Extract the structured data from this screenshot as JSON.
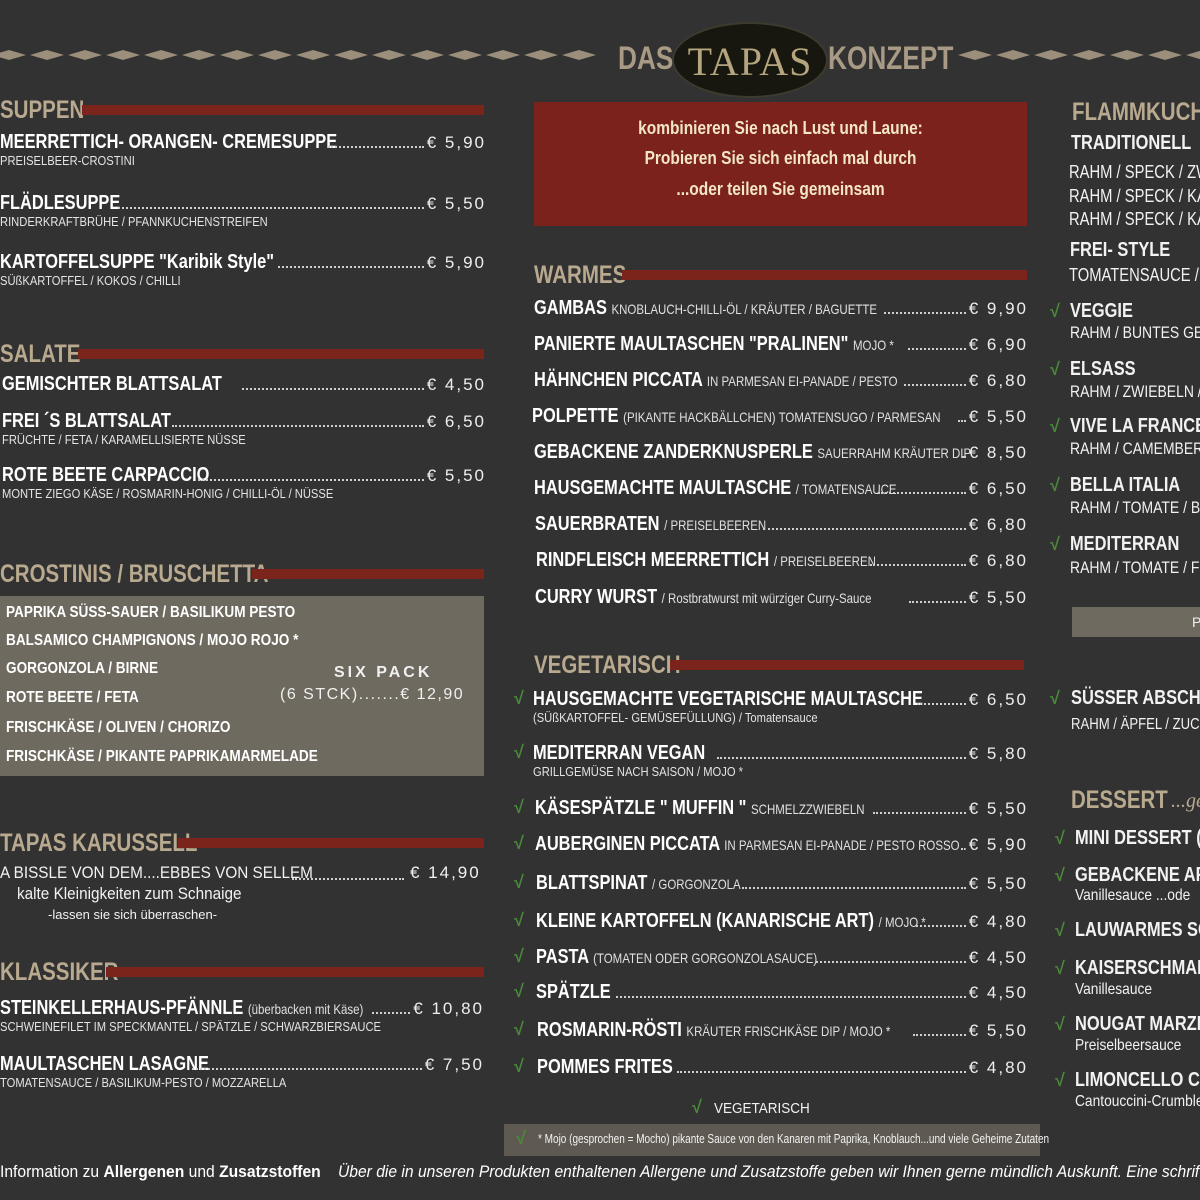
{
  "header": {
    "left_word": "DAS",
    "logo": "TAPAS",
    "right_word": "KONZEPT"
  },
  "left": {
    "suppen": {
      "title": "SUPPEN",
      "items": [
        {
          "name": "MEERRETTICH- ORANGEN- CREMESUPPE",
          "sub": "PREISELBEER-CROSTINI",
          "price": "€ 5,90"
        },
        {
          "name": "FLÄDLESUPPE",
          "sub": "RINDERKRAFTBRÜHE / PFANNKUCHENSTREIFEN",
          "price": "€ 5,50"
        },
        {
          "name": "KARTOFFELSUPPE \"Karibik Style\"",
          "sub": "SÜßKARTOFFEL / KOKOS / CHILLI",
          "price": "€ 5,90"
        }
      ]
    },
    "salate": {
      "title": "SALATE",
      "items": [
        {
          "name": "GEMISCHTER BLATTSALAT",
          "sub": "",
          "price": "€ 4,50"
        },
        {
          "name": "FREI ´S BLATTSALAT",
          "sub": "FRÜCHTE / FETA / KARAMELLISIERTE NÜSSE",
          "price": "€ 6,50"
        },
        {
          "name": "ROTE BEETE CARPACCIO",
          "sub": "MONTE ZIEGO KÄSE / ROSMARIN-HONIG / CHILLI-ÖL / NÜSSE",
          "price": "€ 5,50"
        }
      ]
    },
    "crostinis": {
      "title": "CROSTINIS / BRUSCHETTA",
      "items": [
        "PAPRIKA SÜSS-SAUER / BASILIKUM PESTO",
        "BALSAMICO CHAMPIGNONS / MOJO ROJO *",
        "GORGONZOLA / BIRNE",
        "ROTE BEETE / FETA",
        "FRISCHKÄSE / OLIVEN / CHORIZO",
        "FRISCHKÄSE / PIKANTE PAPRIKAMARMELADE"
      ],
      "six_pack": "SIX PACK",
      "six_pack_price": "(6 STCK).......€ 12,90"
    },
    "karussell": {
      "title": "TAPAS KARUSSELL",
      "line1": "A BISSLE VON DEM....EBBES VON SELLEM",
      "price": "€ 14,90",
      "line2": "kalte Kleinigkeiten zum Schnaige",
      "line3": "-lassen sie sich überraschen-"
    },
    "klassiker": {
      "title": "KLASSIKER",
      "items": [
        {
          "name": "STEINKELLERHAUS-PFÄNNLE",
          "inline": "(überbacken mit Käse)",
          "sub": "SCHWEINEFILET IM SPECKMANTEL / SPÄTZLE / SCHWARZBIERSAUCE",
          "price": "€ 10,80"
        },
        {
          "name": "MAULTASCHEN LASAGNE",
          "inline": "",
          "sub": "TOMATENSAUCE / BASILIKUM-PESTO / MOZZARELLA",
          "price": "€ 7,50"
        }
      ]
    }
  },
  "middle": {
    "intro": [
      "kombinieren Sie nach Lust und Laune:",
      "Probieren Sie sich einfach mal durch",
      "...oder teilen Sie gemeinsam"
    ],
    "warmes": {
      "title": "WARMES",
      "items": [
        {
          "name": "GAMBAS",
          "inline": "KNOBLAUCH-CHILLI-ÖL / KRÄUTER / BAGUETTE",
          "price": "€ 9,90"
        },
        {
          "name": "PANIERTE MAULTASCHEN \"PRALINEN\"",
          "inline": "MOJO *",
          "price": "€ 6,90"
        },
        {
          "name": "HÄHNCHEN PICCATA",
          "inline": "IN PARMESAN  EI-PANADE / PESTO",
          "price": "€ 6,80"
        },
        {
          "name": "POLPETTE",
          "inline": "(PIKANTE HACKBÄLLCHEN) TOMATENSUGO / PARMESAN",
          "price": "€ 5,50"
        },
        {
          "name": "GEBACKENE ZANDERKNUSPERLE",
          "inline": "SAUERRAHM KRÄUTER DIP",
          "price": "€ 8,50"
        },
        {
          "name": "HAUSGEMACHTE MAULTASCHE",
          "inline": "/ TOMATENSAUCE",
          "price": "€ 6,50"
        },
        {
          "name": "SAUERBRATEN",
          "inline": "/ PREISELBEEREN",
          "price": "€ 6,80"
        },
        {
          "name": "RINDFLEISCH MEERRETTICH",
          "inline": "/ PREISELBEEREN",
          "price": "€ 6,80"
        },
        {
          "name": "CURRY WURST",
          "inline": "/ Rostbratwurst mit würziger Curry-Sauce",
          "price": "€ 5,50"
        }
      ]
    },
    "vegetarisch": {
      "title": "VEGETARISCH",
      "items": [
        {
          "name": "HAUSGEMACHTE VEGETARISCHE MAULTASCHE",
          "inline": "",
          "sub": "(SÜßKARTOFFEL- GEMÜSEFÜLLUNG) / Tomatensauce",
          "price": "€ 6,50"
        },
        {
          "name": "MEDITERRAN VEGAN",
          "inline": "",
          "sub": "GRILLGEMÜSE NACH SAISON / MOJO *",
          "price": "€ 5,80"
        },
        {
          "name": "KÄSESPÄTZLE \" MUFFIN \"",
          "inline": "SCHMELZZWIEBELN",
          "sub": "",
          "price": "€ 5,50"
        },
        {
          "name": "AUBERGINEN PICCATA",
          "inline": "IN PARMESAN EI-PANADE / PESTO ROSSO",
          "sub": "",
          "price": "€ 5,90"
        },
        {
          "name": "BLATTSPINAT",
          "inline": "/ GORGONZOLA",
          "sub": "",
          "price": "€ 5,50"
        },
        {
          "name": "KLEINE KARTOFFELN  (KANARISCHE ART)",
          "inline": "/ MOJO *",
          "sub": "",
          "price": "€ 4,80"
        },
        {
          "name": "PASTA",
          "inline": "(TOMATEN ODER GORGONZOLASAUCE)",
          "sub": "",
          "price": "€ 4,50"
        },
        {
          "name": "SPÄTZLE",
          "inline": "",
          "sub": "",
          "price": "€ 4,50"
        },
        {
          "name": "ROSMARIN-RÖSTI",
          "inline": "KRÄUTER FRISCHKÄSE DIP / MOJO *",
          "sub": "",
          "price": "€ 5,50"
        },
        {
          "name": "POMMES FRITES",
          "inline": "",
          "sub": "",
          "price": "€ 4,80"
        }
      ],
      "legend": "VEGETARISCH",
      "check_glyph": "√"
    },
    "mojo_note": "* Mojo (gesprochen = Mocho)  pikante Sauce von den Kanaren  mit Paprika, Knoblauch...und viele Geheime Zutaten"
  },
  "right": {
    "flamm_title": "FLAMMKUCHE",
    "traditionell": "TRADITIONELL",
    "trad_lines": [
      "RAHM / SPECK / ZW",
      "RAHM / SPECK / KÄ",
      "RAHM / SPECK / KÄ"
    ],
    "frei_style": "FREI- STYLE",
    "frei_line": "TOMATENSAUCE / R",
    "items": [
      {
        "name": "VEGGIE",
        "sub": "RAHM / BUNTES GEM"
      },
      {
        "name": "ELSASS",
        "sub": "RAHM / ZWIEBELN /"
      },
      {
        "name": "VIVE LA FRANCE",
        "sub": "RAHM / CAMEMBERT"
      },
      {
        "name": "BELLA ITALIA",
        "sub": "RAHM / TOMATE / BAS"
      },
      {
        "name": "MEDITERRAN",
        "sub": "RAHM / TOMATE / FE"
      }
    ],
    "grey_bar_text": "P",
    "suesser": {
      "name": "SÜSSER ABSCH",
      "sub": "RAHM / ÄPFEL / ZUCK"
    },
    "dessert_title": "DESSERT",
    "dessert_tag": "...ge",
    "desserts": [
      {
        "name": "MINI DESSERT (",
        "sub": ""
      },
      {
        "name": "GEBACKENE AP",
        "sub": "Vanillesauce  ...ode"
      },
      {
        "name": "LAUWARMES SC",
        "sub": ""
      },
      {
        "name": "KAISERSCHMAR",
        "sub": "Vanillesauce"
      },
      {
        "name": "NOUGAT MARZI",
        "sub": "Preiselbeersauce"
      },
      {
        "name": "LIMONCELLO CR",
        "sub": "Cantouccini-Crumble"
      }
    ]
  },
  "footer": {
    "part1": "Information zu ",
    "allergenen": "Allergenen",
    "und": " und ",
    "zusatz": "Zusatzstoffen",
    "part2": "Über die in unseren Produkten enthaltenen Allergene und Zusatzstoffe geben wir Ihnen gerne mündlich Auskunft. Eine schriftlich"
  }
}
